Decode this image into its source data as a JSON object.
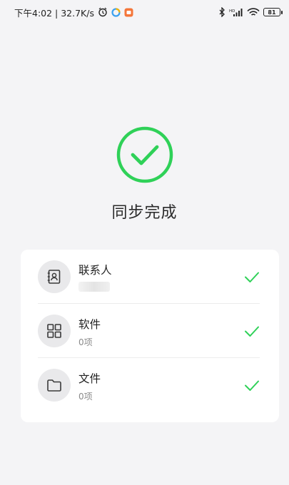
{
  "status_bar": {
    "time_speed": "下午4:02 | 32.7K/s",
    "battery": "81",
    "left_icons": [
      "alarm-icon",
      "app-ring-icon",
      "app-orange-icon"
    ],
    "right_icons": [
      "bluetooth-icon",
      "cellular-signal-icon",
      "wifi-icon"
    ]
  },
  "result": {
    "title": "同步完成",
    "icon": "check-circle-icon",
    "accent_color": "#2fd158"
  },
  "items": [
    {
      "icon": "contacts-icon",
      "title": "联系人",
      "subtitle": ""
    },
    {
      "icon": "apps-grid-icon",
      "title": "软件",
      "subtitle": "0项"
    },
    {
      "icon": "folder-icon",
      "title": "文件",
      "subtitle": "0项"
    }
  ]
}
